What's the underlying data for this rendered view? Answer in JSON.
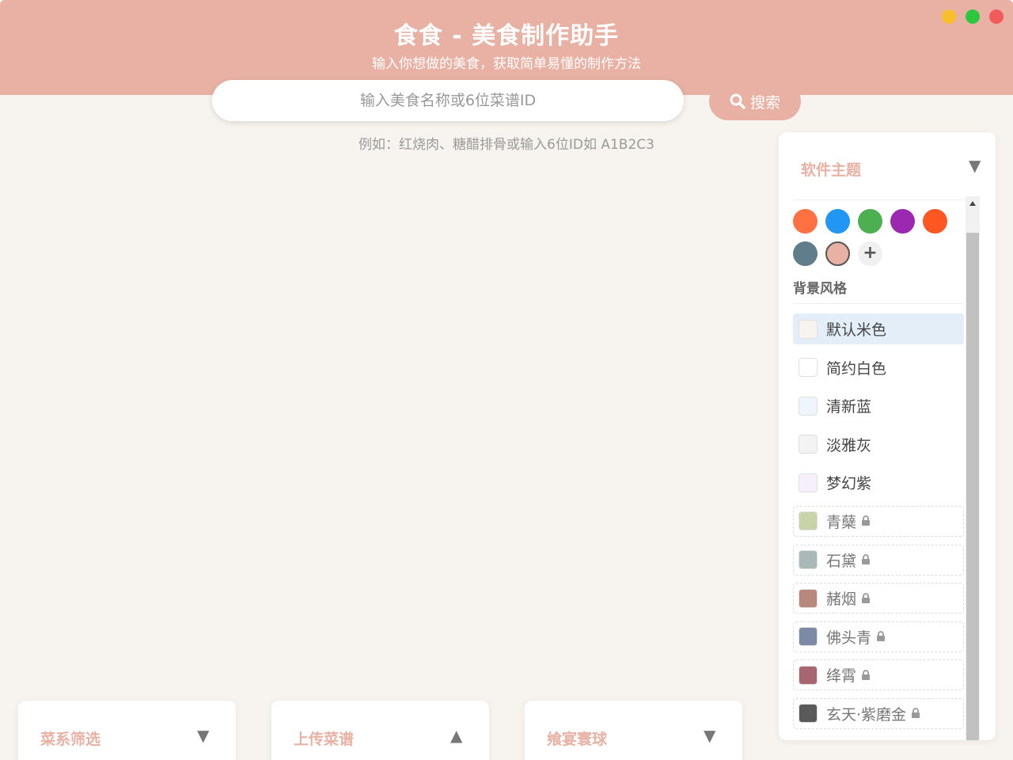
{
  "header": {
    "title": "食食 - 美食制作助手",
    "subtitle": "输入你想做的美食，获取简单易懂的制作方法",
    "bg_color": "#e8b1a3"
  },
  "search": {
    "placeholder": "输入美食名称或6位菜谱ID",
    "button_label": "搜索",
    "hint": "例如：红烧肉、糖醋排骨或输入6位ID如 A1B2C3"
  },
  "theme_panel": {
    "title": "软件主题",
    "toggle": "▼",
    "colors": [
      "#ff7043",
      "#2196f3",
      "#4caf50",
      "#9c27b0",
      "#ff5722",
      "#607d8b",
      "#e8b1a3"
    ],
    "selected_color": "#e8b1a3",
    "add_label": "+",
    "background_label": "背景风格",
    "backgrounds": [
      {
        "name": "默认米色",
        "color": "#f7f4ef",
        "active": true,
        "locked": false
      },
      {
        "name": "简约白色",
        "color": "#ffffff",
        "active": false,
        "locked": false
      },
      {
        "name": "清新蓝",
        "color": "#eef5fd",
        "active": false,
        "locked": false
      },
      {
        "name": "淡雅灰",
        "color": "#f3f3f3",
        "active": false,
        "locked": false
      },
      {
        "name": "梦幻紫",
        "color": "#f5f0fc",
        "active": false,
        "locked": false
      },
      {
        "name": "青蘖",
        "color": "#c9d3a8",
        "active": false,
        "locked": true
      },
      {
        "name": "石黛",
        "color": "#a9b9b8",
        "active": false,
        "locked": true
      },
      {
        "name": "赭烟",
        "color": "#b8887d",
        "active": false,
        "locked": true
      },
      {
        "name": "佛头青",
        "color": "#7d8aa6",
        "active": false,
        "locked": true
      },
      {
        "name": "绛霄",
        "color": "#a86670",
        "active": false,
        "locked": true
      },
      {
        "name": "玄天·紫磨金",
        "color": "#5a5a5a",
        "active": false,
        "locked": true
      }
    ]
  },
  "cards": [
    {
      "title": "菜系筛选",
      "toggle": "▼"
    },
    {
      "title": "上传菜谱",
      "toggle": "▲"
    },
    {
      "title": "飨宴寰球",
      "toggle": "▼"
    }
  ]
}
